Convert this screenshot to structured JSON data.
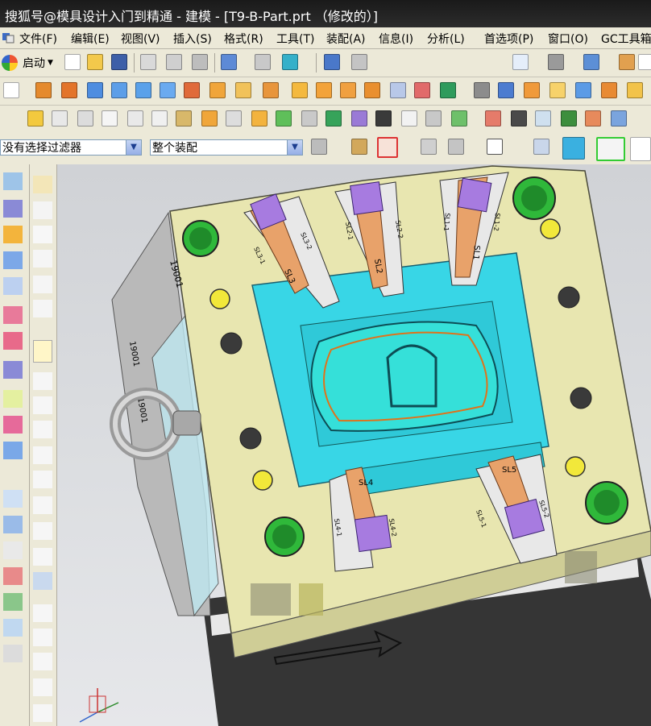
{
  "window": {
    "title": "搜狐号@模具设计入门到精通 - 建模 - [T9-B-Part.prt （修改的）]"
  },
  "menu": {
    "items": [
      "文件(F)",
      "编辑(E)",
      "视图(V)",
      "插入(S)",
      "格式(R)",
      "工具(T)",
      "装配(A)",
      "信息(I)",
      "分析(L)",
      "首选项(P)",
      "窗口(O)",
      "GC工具箱"
    ]
  },
  "toolbar": {
    "start_label": "启动"
  },
  "filters": {
    "selection_filter": "没有选择过滤器",
    "scope": "整个装配"
  },
  "model": {
    "slider_labels": [
      "SL1",
      "SL2",
      "SL3",
      "SL4",
      "SL5"
    ],
    "side_labels": [
      "SL3-1",
      "SL3-2",
      "SL2-1",
      "SL2-2",
      "SL1-1",
      "SL1-2",
      "SL4-1",
      "SL4-2",
      "SL5-1",
      "SL5-2"
    ],
    "plate_markings": [
      "19001",
      "19001",
      "19001"
    ]
  },
  "colors": {
    "plate": "#e8e6b0",
    "core_plate": "#38d6e6",
    "slider_body": "#e8a26a",
    "slider_block": "#a77be0",
    "guide_bushing": "#2fb83a",
    "water_plug": "#f2e83a",
    "base": "#3a3a3a"
  }
}
